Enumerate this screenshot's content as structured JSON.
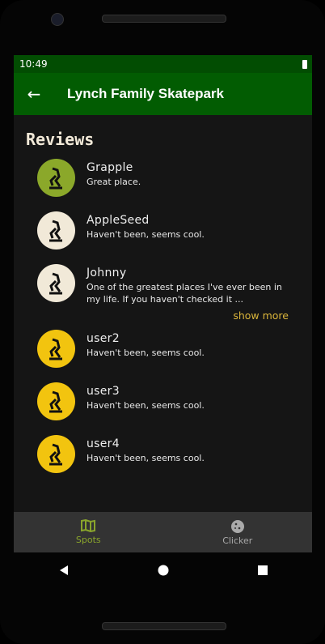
{
  "status": {
    "time": "10:49"
  },
  "appbar": {
    "title": "Lynch Family Skatepark"
  },
  "section_title": "Reviews",
  "reviews": [
    {
      "name": "Grapple",
      "text": "Great place.",
      "avatar_color": "#8ba82a"
    },
    {
      "name": "AppleSeed",
      "text": "Haven't been, seems cool.",
      "avatar_color": "#f1e9d8"
    },
    {
      "name": "Johnny",
      "text": "One of the greatest places I've ever been in my life. If you haven't checked it ...",
      "avatar_color": "#f1e9d8",
      "more": "show more"
    },
    {
      "name": "user2",
      "text": "Haven't been, seems cool.",
      "avatar_color": "#f2c40f"
    },
    {
      "name": "user3",
      "text": "Haven't been, seems cool.",
      "avatar_color": "#f2c40f"
    },
    {
      "name": "user4",
      "text": "Haven't been, seems cool.",
      "avatar_color": "#f2c40f"
    }
  ],
  "nav": [
    {
      "label": "Spots",
      "icon": "map-icon"
    },
    {
      "label": "Clicker",
      "icon": "cookie-icon"
    }
  ]
}
